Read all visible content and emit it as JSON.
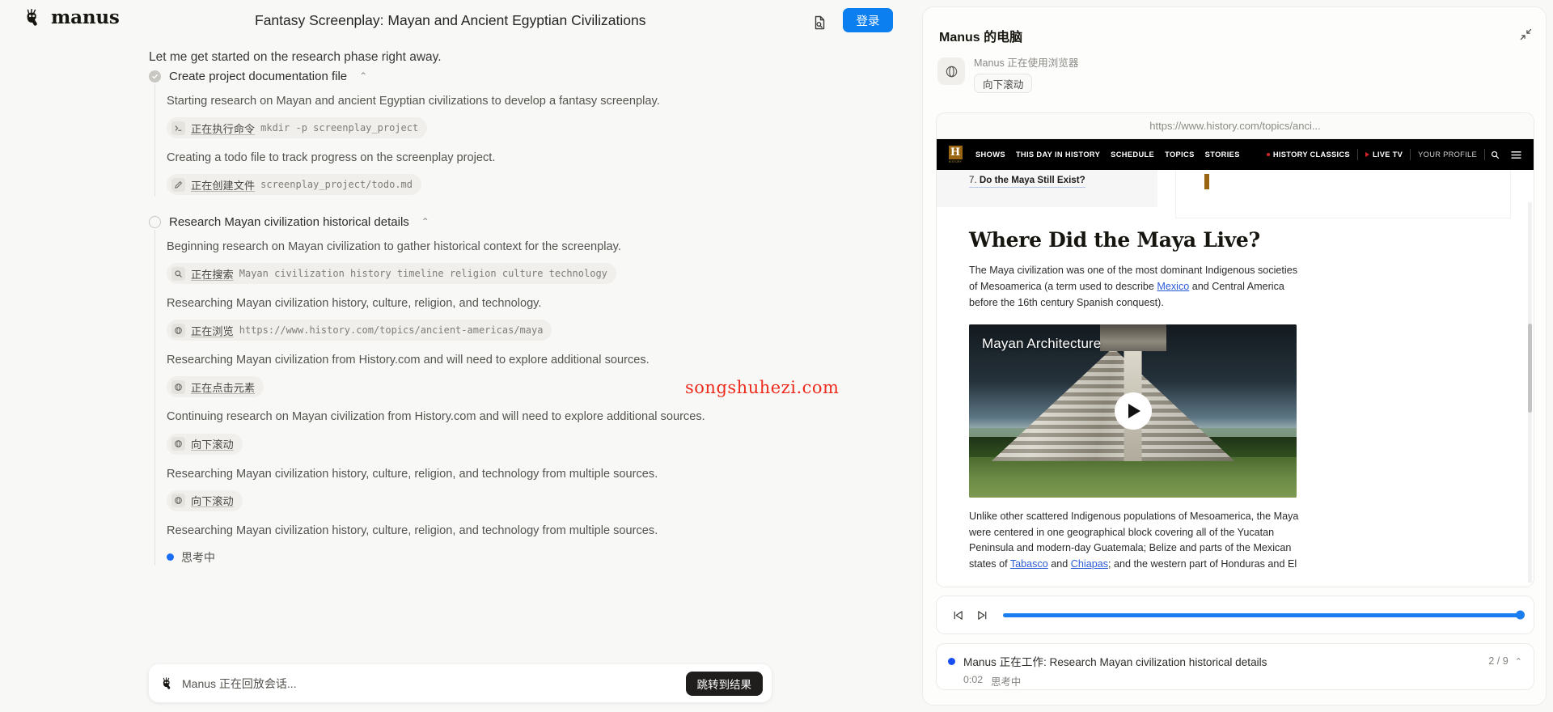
{
  "app": {
    "brand": "manus",
    "conversation_title": "Fantasy Screenplay: Mayan and Ancient Egyptian Civilizations",
    "login_label": "登录",
    "doc_icon": "document-search-icon"
  },
  "thread": {
    "intro": "Let me get started on the research phase right away.",
    "steps": [
      {
        "title": "Create project documentation file",
        "state": "done",
        "chevron": "⌃",
        "items": [
          {
            "kind": "message",
            "text": "Starting research on Mayan and ancient Egyptian civilizations to develop a fantasy screenplay."
          },
          {
            "kind": "chip",
            "icon": "terminal-icon",
            "label": "正在执行命令",
            "code": "mkdir -p screenplay_project"
          },
          {
            "kind": "message",
            "text": "Creating a todo file to track progress on the screenplay project."
          },
          {
            "kind": "chip",
            "icon": "pencil-icon",
            "label": "正在创建文件",
            "code": "screenplay_project/todo.md"
          }
        ]
      },
      {
        "title": "Research Mayan civilization historical details",
        "state": "pending",
        "chevron": "⌃",
        "items": [
          {
            "kind": "message",
            "text": "Beginning research on Mayan civilization to gather historical context for the screenplay."
          },
          {
            "kind": "chip",
            "icon": "search-icon",
            "label": "正在搜索",
            "code": "Mayan civilization history timeline religion culture technology"
          },
          {
            "kind": "message",
            "text": "Researching Mayan civilization history, culture, religion, and technology."
          },
          {
            "kind": "chip",
            "icon": "browser-icon",
            "label": "正在浏览",
            "code": "https://www.history.com/topics/ancient-americas/maya"
          },
          {
            "kind": "message",
            "text": "Researching Mayan civilization from History.com and will need to explore additional sources."
          },
          {
            "kind": "chip",
            "icon": "browser-icon",
            "label": "正在点击元素",
            "code": ""
          },
          {
            "kind": "message",
            "text": "Continuing research on Mayan civilization from History.com and will need to explore additional sources."
          },
          {
            "kind": "chip",
            "icon": "browser-icon",
            "label": "向下滚动",
            "code": ""
          },
          {
            "kind": "message",
            "text": "Researching Mayan civilization history, culture, religion, and technology from multiple sources."
          },
          {
            "kind": "chip",
            "icon": "browser-icon",
            "label": "向下滚动",
            "code": ""
          },
          {
            "kind": "message",
            "text": "Researching Mayan civilization history, culture, religion, and technology from multiple sources."
          },
          {
            "kind": "thinking",
            "text": "思考中"
          }
        ]
      }
    ]
  },
  "watermark": "songshuhezi.com",
  "replay_bar": {
    "text": "Manus 正在回放会话...",
    "jump_label": "跳转到结果",
    "logo_icon": "manus-logo-icon"
  },
  "right_panel": {
    "title": "Manus 的电脑",
    "collapse_icon": "collapse-icon",
    "tool_icon": "browser-icon",
    "tool_caption": "Manus 正在使用浏览器",
    "tool_action": "向下滚动",
    "browser": {
      "url": "https://www.history.com/topics/anci...",
      "site_nav": {
        "logo_letter": "H",
        "logo_sub": "HISTORY",
        "left_items": [
          "SHOWS",
          "THIS DAY IN HISTORY",
          "SCHEDULE",
          "TOPICS",
          "STORIES"
        ],
        "right_items": [
          "HISTORY CLASSICS",
          "LIVE TV",
          "YOUR PROFILE"
        ],
        "search_icon": "search-icon",
        "menu_icon": "hamburger-menu-icon"
      },
      "page": {
        "toc_number": "7.",
        "toc_label": "Do the Maya Still Exist?",
        "heading": "Where Did the Maya Live?",
        "paragraph1_a": "The Maya civilization was one of the most dominant Indigenous societies of Mesoamerica (a term used to describe ",
        "paragraph1_link": "Mexico",
        "paragraph1_b": " and Central America before the 16th century Spanish conquest).",
        "video_title": "Mayan Architecture",
        "play_icon": "play-icon",
        "paragraph2_a": "Unlike other scattered Indigenous populations of Mesoamerica, the Maya were centered in one geographical block covering all of the Yucatan Peninsula and modern-day Guatemala; Belize and parts of the Mexican states of ",
        "paragraph2_link1": "Tabasco",
        "paragraph2_mid": " and ",
        "paragraph2_link2": "Chiapas",
        "paragraph2_b": "; and the western part of Honduras and El"
      }
    },
    "player": {
      "prev_icon": "skip-to-start-icon",
      "next_icon": "step-forward-icon",
      "progress_percent": 100
    },
    "status": {
      "dot_color": "#1a4ef5",
      "text": "Manus 正在工作: Research Mayan civilization historical details",
      "count": "2 / 9",
      "chevron": "⌃",
      "time": "0:02",
      "state": "思考中"
    }
  }
}
